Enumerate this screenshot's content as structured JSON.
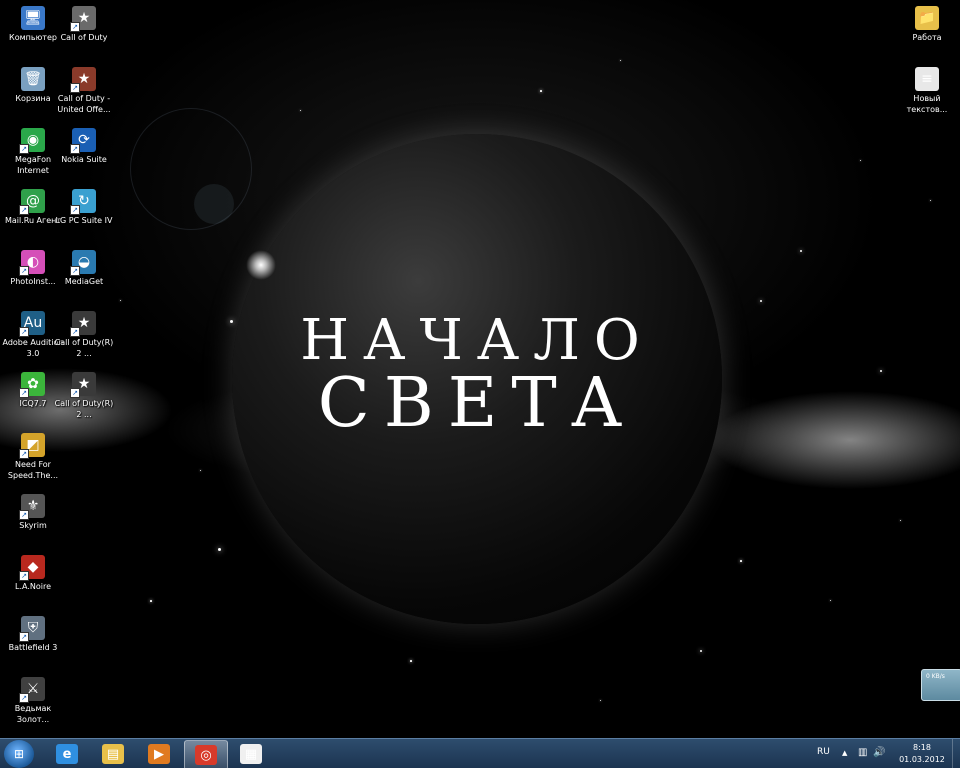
{
  "wallpaper": {
    "title_line_1": "НАЧАЛО",
    "title_line_2": "СВЕТА"
  },
  "desktop_icons_left": [
    {
      "name": "icon-computer",
      "label": "Компьютер",
      "icon": "computer-icon",
      "glyph": "🖥",
      "color": "#3a78c8",
      "shortcut": false
    },
    {
      "name": "icon-recycle-bin",
      "label": "Корзина",
      "icon": "recycle-bin-icon",
      "glyph": "🗑",
      "color": "#7aa0c0",
      "shortcut": false
    },
    {
      "name": "icon-megafon-internet",
      "label": "MegaFon Internet",
      "icon": "megafon-icon",
      "glyph": "◉",
      "color": "#2aa84a",
      "shortcut": true
    },
    {
      "name": "icon-mailru-agent",
      "label": "Mail.Ru Агент",
      "icon": "mailru-agent-icon",
      "glyph": "@",
      "color": "#2fa04a",
      "shortcut": true
    },
    {
      "name": "icon-photoinstrument",
      "label": "PhotoInst...",
      "icon": "photoinstrument-icon",
      "glyph": "◐",
      "color": "#d54fb8",
      "shortcut": true
    },
    {
      "name": "icon-adobe-audition",
      "label": "Adobe Audition 3.0",
      "icon": "adobe-audition-icon",
      "glyph": "Au",
      "color": "#1f5f86",
      "shortcut": true
    },
    {
      "name": "icon-icq",
      "label": "ICQ7.7",
      "icon": "icq-flower-icon",
      "glyph": "✿",
      "color": "#3bb53b",
      "shortcut": true
    },
    {
      "name": "icon-need-for-speed",
      "label": "Need For Speed.The...",
      "icon": "need-for-speed-icon",
      "glyph": "◩",
      "color": "#d4a32a",
      "shortcut": true
    },
    {
      "name": "icon-skyrim",
      "label": "Skyrim",
      "icon": "skyrim-icon",
      "glyph": "⚜",
      "color": "#555555",
      "shortcut": true
    },
    {
      "name": "icon-la-noire",
      "label": "L.A.Noire",
      "icon": "la-noire-icon",
      "glyph": "◆",
      "color": "#b8281e",
      "shortcut": true
    },
    {
      "name": "icon-battlefield-3",
      "label": "Battlefield 3",
      "icon": "battlefield-icon",
      "glyph": "⛨",
      "color": "#607080",
      "shortcut": true
    },
    {
      "name": "icon-witcher",
      "label": "Ведьмак Золот...",
      "icon": "witcher-icon",
      "glyph": "⚔",
      "color": "#404040",
      "shortcut": true
    }
  ],
  "desktop_icons_col2": [
    {
      "name": "icon-call-of-duty",
      "label": "Call of Duty",
      "icon": "call-of-duty-star-icon",
      "glyph": "★",
      "color": "#6a6a6a",
      "shortcut": true
    },
    {
      "name": "icon-call-of-duty-united",
      "label": "Call of Duty - United Offe...",
      "icon": "call-of-duty-united-icon",
      "glyph": "★",
      "color": "#8a3a2a",
      "shortcut": true
    },
    {
      "name": "icon-nokia-suite",
      "label": "Nokia Suite",
      "icon": "nokia-suite-icon",
      "glyph": "⟳",
      "color": "#1a5fb4",
      "shortcut": true
    },
    {
      "name": "icon-lg-pc-suite",
      "label": "LG PC Suite IV",
      "icon": "lg-pc-suite-icon",
      "glyph": "↻",
      "color": "#3aa0d0",
      "shortcut": true
    },
    {
      "name": "icon-mediaget",
      "label": "MediaGet",
      "icon": "mediaget-icon",
      "glyph": "◒",
      "color": "#2a7ab0",
      "shortcut": true
    },
    {
      "name": "icon-call-of-duty-2",
      "label": "Call of Duty(R) 2 ...",
      "icon": "call-of-duty-2-icon",
      "glyph": "★",
      "color": "#3a3a3a",
      "shortcut": true
    },
    {
      "name": "icon-call-of-duty-2b",
      "label": "Call of Duty(R) 2 ...",
      "icon": "call-of-duty-2-icon",
      "glyph": "★",
      "color": "#3a3a3a",
      "shortcut": true
    }
  ],
  "desktop_icons_right": [
    {
      "name": "icon-folder-rabota",
      "label": "Работа",
      "icon": "folder-icon",
      "glyph": "📁",
      "color": "#e8c04a",
      "shortcut": false
    },
    {
      "name": "icon-new-text-doc",
      "label": "Новый текстов...",
      "icon": "text-document-icon",
      "glyph": "≡",
      "color": "#e8e8e8",
      "shortcut": false
    }
  ],
  "gadget": {
    "speed": "0 KB/s"
  },
  "taskbar": {
    "buttons": [
      {
        "name": "taskbar-internet-explorer",
        "icon": "internet-explorer-icon",
        "glyph": "e",
        "color": "#2f8fe0",
        "active": false
      },
      {
        "name": "taskbar-explorer",
        "icon": "folder-explorer-icon",
        "glyph": "▤",
        "color": "#e8c04a",
        "active": false
      },
      {
        "name": "taskbar-media-player",
        "icon": "media-player-icon",
        "glyph": "▶",
        "color": "#e07a20",
        "active": false
      },
      {
        "name": "taskbar-chrome",
        "icon": "chrome-icon",
        "glyph": "◎",
        "color": "#d83a2a",
        "active": true
      },
      {
        "name": "taskbar-notepad",
        "icon": "notepad-icon",
        "glyph": "▦",
        "color": "#f0f0f0",
        "active": false
      }
    ],
    "tray": {
      "language": "RU",
      "show_hidden_glyph": "▲",
      "network_glyph": "▥",
      "volume_glyph": "🔊",
      "time": "8:18",
      "date": "01.03.2012"
    }
  }
}
